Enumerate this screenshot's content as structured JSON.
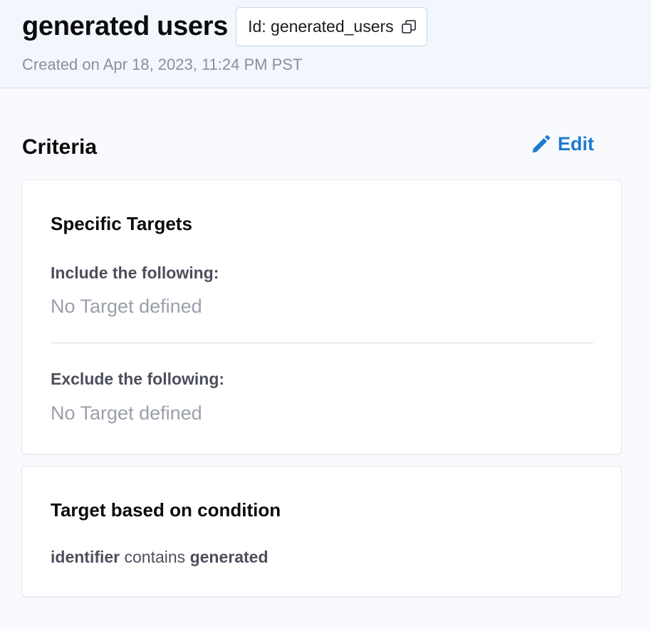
{
  "header": {
    "title": "generated users",
    "id_label": "Id: generated_users",
    "created": "Created on Apr 18, 2023, 11:24 PM PST"
  },
  "criteria": {
    "title": "Criteria",
    "edit_label": "Edit"
  },
  "specific_targets": {
    "title": "Specific Targets",
    "include_label": "Include the following:",
    "include_value": "No Target defined",
    "exclude_label": "Exclude the following:",
    "exclude_value": "No Target defined"
  },
  "condition_card": {
    "title": "Target based on condition",
    "attribute": "identifier",
    "operator": "contains",
    "value": "generated"
  },
  "colors": {
    "accent": "#1e7ad0",
    "header_bg": "#f1f7fd"
  },
  "icons": {
    "copy": "copy-icon",
    "edit": "pencil-icon"
  }
}
